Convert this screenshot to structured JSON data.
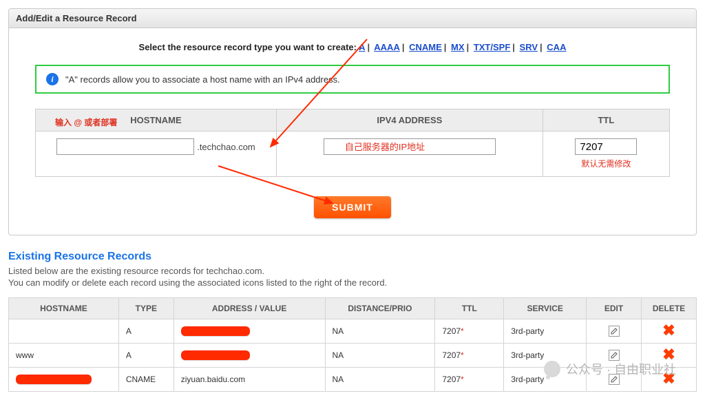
{
  "panel": {
    "title": "Add/Edit a Resource Record",
    "selectLabel": "Select the resource record type you want to create:",
    "types": [
      "A",
      "AAAA",
      "CNAME",
      "MX",
      "TXT/SPF",
      "SRV",
      "CAA"
    ],
    "infoText": "\"A\" records allow you to associate a host name with an IPv4 address."
  },
  "form": {
    "headers": {
      "hostname": "HOSTNAME",
      "ipv4": "IPV4 ADDRESS",
      "ttl": "TTL"
    },
    "hostnameNote": "输入 @ 或者部署",
    "domainSuffix": ".techchao.com",
    "ipv4Placeholder": "自己服务器的IP地址",
    "ttlValue": "7207",
    "ttlNote": "默认无需修改",
    "submitLabel": "SUBMIT"
  },
  "existing": {
    "heading": "Existing Resource Records",
    "line1": "Listed below are the existing resource records for techchao.com.",
    "line2": "You can modify or delete each record using the associated icons listed to the right of the record.",
    "columns": {
      "hostname": "HOSTNAME",
      "type": "TYPE",
      "address": "ADDRESS / VALUE",
      "distance": "DISTANCE/PRIO",
      "ttl": "TTL",
      "service": "SERVICE",
      "edit": "EDIT",
      "delete": "DELETE"
    },
    "rows": [
      {
        "hostname": "",
        "type": "A",
        "address": "[redacted]",
        "distance": "NA",
        "ttl": "7207",
        "star": "*",
        "service": "3rd-party"
      },
      {
        "hostname": "www",
        "type": "A",
        "address": "[redacted]",
        "distance": "NA",
        "ttl": "7207",
        "star": "*",
        "service": "3rd-party"
      },
      {
        "hostname": "[redacted]",
        "type": "CNAME",
        "address": "ziyuan.baidu.com",
        "distance": "NA",
        "ttl": "7207",
        "star": "*",
        "service": "3rd-party"
      }
    ]
  },
  "watermark": "公众号 · 自由职业社"
}
